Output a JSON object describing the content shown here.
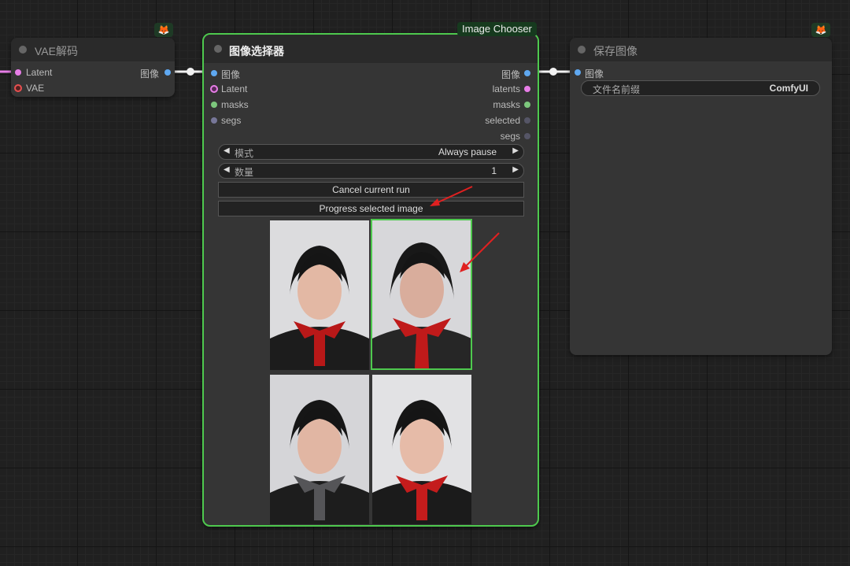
{
  "nodes": {
    "vae_decode": {
      "title": "VAE解码",
      "inputs": [
        "Latent",
        "VAE"
      ],
      "output": "图像"
    },
    "image_chooser": {
      "badge": "Image Chooser",
      "title": "图像选择器",
      "inputs": [
        "图像",
        "Latent",
        "masks",
        "segs"
      ],
      "outputs": [
        "图像",
        "latents",
        "masks",
        "selected",
        "segs"
      ],
      "mode": {
        "label": "模式",
        "value": "Always pause"
      },
      "count": {
        "label": "数量",
        "value": "1"
      },
      "cancel_button": "Cancel current run",
      "progress_button": "Progress selected image"
    },
    "save_image": {
      "title": "保存图像",
      "input": "图像",
      "prefix": {
        "label": "文件名前缀",
        "value": "ComfyUI"
      }
    }
  },
  "icons": {
    "node_badge": "🦊"
  },
  "colors": {
    "selected_outline": "#4ec94e",
    "image_slot": "#5fa8f0",
    "latent_slot": "#e87ee8",
    "mask_slot": "#7dc77d",
    "vae_slot": "#e85050",
    "segs_slot": "#777799",
    "arrow": "#e02020"
  }
}
